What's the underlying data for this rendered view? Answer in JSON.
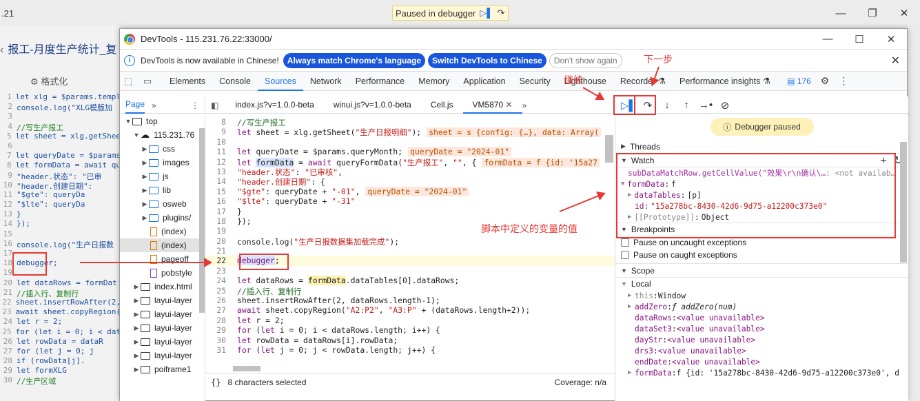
{
  "background": {
    "left_number": ".21",
    "paused_label": "Paused in debugger",
    "tab_title": "报工-月度生产统计_复",
    "format_label": "格式化",
    "code_lines": [
      {
        "n": "1",
        "t": "let xlg = $params.templ"
      },
      {
        "n": "2",
        "t": "console.log(\"XLG模版加"
      },
      {
        "n": "3",
        "t": ""
      },
      {
        "n": "4",
        "t": "//写生产报工",
        "c": true
      },
      {
        "n": "5",
        "t": "let sheet = xlg.getShee"
      },
      {
        "n": "6",
        "t": ""
      },
      {
        "n": "7",
        "t": "let queryDate = $params"
      },
      {
        "n": "8",
        "t": "let formData = await qu"
      },
      {
        "n": "9",
        "t": "    \"header.状态\": \"已审"
      },
      {
        "n": "10",
        "t": "    \"header.创建日期\":"
      },
      {
        "n": "11",
        "t": "        \"$gte\": queryDa"
      },
      {
        "n": "12",
        "t": "        \"$lte\": queryDa"
      },
      {
        "n": "13",
        "t": "    }"
      },
      {
        "n": "14",
        "t": "});"
      },
      {
        "n": "15",
        "t": ""
      },
      {
        "n": "16",
        "t": "console.log(\"生产日报数"
      },
      {
        "n": "17",
        "t": ""
      },
      {
        "n": "18",
        "t": "debugger;"
      },
      {
        "n": "19",
        "t": ""
      },
      {
        "n": "20",
        "t": "let dataRows = formDat"
      },
      {
        "n": "21",
        "t": "//插入行、复制行",
        "c": true
      },
      {
        "n": "22",
        "t": "sheet.insertRowAfter(2,"
      },
      {
        "n": "23",
        "t": "await sheet.copyRegion("
      },
      {
        "n": "24",
        "t": "let r = 2;"
      },
      {
        "n": "25",
        "t": "for (let i = 0; i < dat"
      },
      {
        "n": "26",
        "t": "    let rowData = dataR"
      },
      {
        "n": "27",
        "t": "    for (let j = 0; j"
      },
      {
        "n": "28",
        "t": "        if (rowData[j]."
      },
      {
        "n": "29",
        "t": "            let formXLG"
      },
      {
        "n": "30",
        "t": "            //生产区域",
        "c": true
      }
    ]
  },
  "devtools": {
    "title": "DevTools - 115.231.76.22:33000/",
    "infobar": {
      "message": "DevTools is now available in Chinese!",
      "btn_match": "Always match Chrome's language",
      "btn_switch": "Switch DevTools to Chinese",
      "btn_dismiss": "Don't show again"
    },
    "tabs": [
      "Elements",
      "Console",
      "Sources",
      "Network",
      "Performance",
      "Memory",
      "Application",
      "Security",
      "Lighthouse",
      "Recorder ⚗",
      "Performance insights ⚗"
    ],
    "active_tab": "Sources",
    "issues_count": "176",
    "navigator": {
      "tab_label": "Page",
      "items": [
        {
          "label": "top",
          "depth": 0,
          "kind": "frame",
          "open": true
        },
        {
          "label": "115.231.76",
          "depth": 1,
          "kind": "cloud",
          "open": true
        },
        {
          "label": "css",
          "depth": 2,
          "kind": "folder"
        },
        {
          "label": "images",
          "depth": 2,
          "kind": "folder"
        },
        {
          "label": "js",
          "depth": 2,
          "kind": "folder"
        },
        {
          "label": "lib",
          "depth": 2,
          "kind": "folder"
        },
        {
          "label": "osweb",
          "depth": 2,
          "kind": "folder"
        },
        {
          "label": "plugins/",
          "depth": 2,
          "kind": "folder"
        },
        {
          "label": "(index)",
          "depth": 2,
          "kind": "file-orange"
        },
        {
          "label": "(index)",
          "depth": 2,
          "kind": "file-orange",
          "selected": true
        },
        {
          "label": "pageoff",
          "depth": 2,
          "kind": "file-orange"
        },
        {
          "label": "pobstyle",
          "depth": 2,
          "kind": "file-purple"
        },
        {
          "label": "index.html",
          "depth": 1,
          "kind": "frame"
        },
        {
          "label": "layui-layer",
          "depth": 1,
          "kind": "frame"
        },
        {
          "label": "layui-layer",
          "depth": 1,
          "kind": "frame"
        },
        {
          "label": "layui-layer",
          "depth": 1,
          "kind": "frame"
        },
        {
          "label": "layui-layer",
          "depth": 1,
          "kind": "frame"
        },
        {
          "label": "layui-layer",
          "depth": 1,
          "kind": "frame"
        },
        {
          "label": "poiframe1",
          "depth": 1,
          "kind": "frame"
        }
      ]
    },
    "file_tabs": [
      "index.js?v=1.0.0-beta",
      "winui.js?v=1.0.0-beta",
      "Cell.js",
      "VM5870"
    ],
    "active_file": "VM5870",
    "code": [
      {
        "n": "8",
        "html": "<span class='com'>//写生产报工</span>"
      },
      {
        "n": "9",
        "html": "<span class='kw'>let</span> sheet = xlg.getSheet(<span class='str'>\"生产日报明细\"</span>);<span class='inl'>sheet = s {config: {…}, data: Array(</span>"
      },
      {
        "n": "10",
        "html": ""
      },
      {
        "n": "11",
        "html": "<span class='kw'>let</span> queryDate = $params.queryMonth;<span class='inl'>queryDate = \"2024-01\"</span>"
      },
      {
        "n": "12",
        "html": "<span class='kw'>let</span> <span class='hl'>formData</span> = <span class='kw'>await</span> queryFormData(<span class='str'>\"生产报工\"</span>, <span class='str'>\"\"</span>, {<span class='inl'>formData = f {id: '15a27</span>"
      },
      {
        "n": "13",
        "html": "    <span class='str'>\"header.状态\"</span>: <span class='str'>\"已审核\"</span>,"
      },
      {
        "n": "14",
        "html": "    <span class='str'>\"header.创建日期\"</span>: {"
      },
      {
        "n": "15",
        "html": "        <span class='str'>\"$gte\"</span>: queryDate + <span class='str'>\"-01\"</span>,<span class='inl'>queryDate = \"2024-01\"</span>"
      },
      {
        "n": "16",
        "html": "        <span class='str'>\"$lte\"</span>: queryDate + <span class='str'>\"-31\"</span>"
      },
      {
        "n": "17",
        "html": "    }"
      },
      {
        "n": "18",
        "html": "});"
      },
      {
        "n": "19",
        "html": ""
      },
      {
        "n": "20",
        "html": "console.log(<span class='str'>\"生产日报数据集加载完成\"</span>);"
      },
      {
        "n": "21",
        "html": ""
      },
      {
        "n": "22",
        "html": "<span class='hl kw'>debugger</span>;",
        "current": true
      },
      {
        "n": "23",
        "html": ""
      },
      {
        "n": "24",
        "html": "<span class='kw'>let</span> dataRows = <span style='background:#fdf3b0'>formData</span>.dataTables[0].dataRows;"
      },
      {
        "n": "25",
        "html": "<span class='com'>//插入行、复制行</span>"
      },
      {
        "n": "26",
        "html": "sheet.insertRowAfter(2, dataRows.length-1);"
      },
      {
        "n": "27",
        "html": "<span class='kw'>await</span> sheet.copyRegion(<span class='str'>\"A2:P2\"</span>, <span class='str'>\"A3:P\"</span> + (dataRows.length+2));"
      },
      {
        "n": "28",
        "html": "<span class='kw'>let</span> r = 2;"
      },
      {
        "n": "29",
        "html": "<span class='kw'>for</span> (<span class='kw'>let</span> i = 0; i &lt; dataRows.length; i++) {"
      },
      {
        "n": "30",
        "html": "    <span class='kw'>let</span> rowData = dataRows[i].rowData;"
      },
      {
        "n": "31",
        "html": "    <span class='kw'>for</span> (<span class='kw'>let</span> j = 0; j &lt; rowData.length; j++) {"
      }
    ],
    "status": {
      "selected": "8 characters selected",
      "coverage": "Coverage: n/a"
    },
    "right": {
      "paused": "Debugger paused",
      "threads": "Threads",
      "watch": "Watch",
      "watch_expr": "subDataMatchRow.getCellValue(\"效果\\r\\n确认\\…",
      "watch_expr_val": ": <not availab…",
      "watch_form": "formData",
      "watch_form_type": "f",
      "watch_datatables_key": "dataTables",
      "watch_datatables_val": "[p]",
      "watch_id_key": "id",
      "watch_id_val": "\"15a278bc-8430-42d6-9d75-a12200c373e0\"",
      "watch_proto": "[[Prototype]]",
      "watch_proto_val": "Object",
      "breakpoints": "Breakpoints",
      "pause_uncaught": "Pause on uncaught exceptions",
      "pause_caught": "Pause on caught exceptions",
      "scope": "Scope",
      "local": "Local",
      "scope_rows": [
        {
          "k": "this",
          "v": "Window",
          "arrow": true,
          "gray": true
        },
        {
          "k": "addZero",
          "v": "ƒ addZero(num)",
          "arrow": true,
          "italic": true
        },
        {
          "k": "dataRows",
          "v": "<value unavailable>"
        },
        {
          "k": "dataSet3",
          "v": "<value unavailable>"
        },
        {
          "k": "dayStr",
          "v": "<value unavailable>"
        },
        {
          "k": "drs3",
          "v": "<value unavailable>"
        },
        {
          "k": "endDate",
          "v": "<value unavailable>"
        },
        {
          "k": "formData",
          "v": "f {id: '15a278bc-8430-42d6-9d75-a12200c373e0', d",
          "arrow": true
        }
      ]
    }
  },
  "annotations": {
    "resume": "继续",
    "step": "下一步",
    "vars": "脚本中定义的变量的值"
  }
}
